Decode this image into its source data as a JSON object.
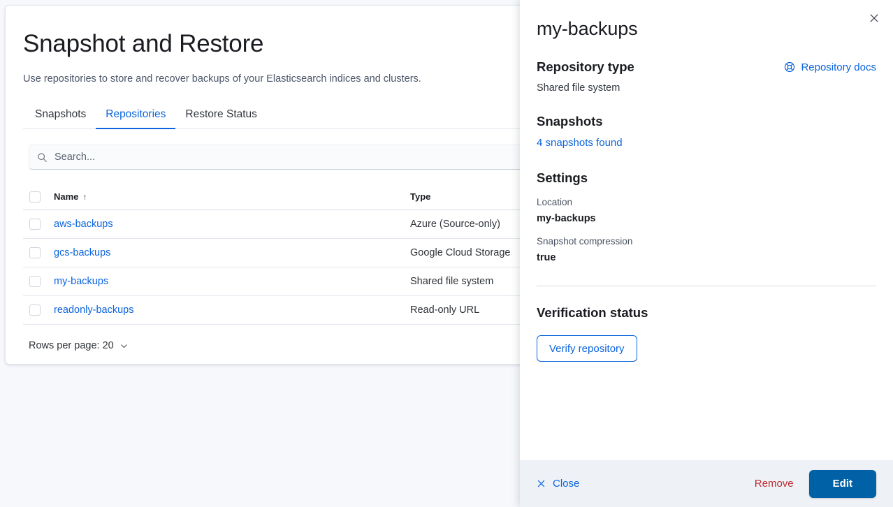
{
  "page": {
    "title": "Snapshot and Restore",
    "subtitle": "Use repositories to store and recover backups of your Elasticsearch indices and clusters."
  },
  "tabs": [
    {
      "label": "Snapshots",
      "active": false
    },
    {
      "label": "Repositories",
      "active": true
    },
    {
      "label": "Restore Status",
      "active": false
    }
  ],
  "search": {
    "placeholder": "Search...",
    "value": "",
    "icon": "search-icon"
  },
  "table": {
    "columns": [
      {
        "key": "name",
        "label": "Name",
        "sorted": true,
        "sort_arrow": "↑"
      },
      {
        "key": "type",
        "label": "Type"
      }
    ],
    "rows": [
      {
        "name": "aws-backups",
        "type": "Azure (Source-only)"
      },
      {
        "name": "gcs-backups",
        "type": "Google Cloud Storage"
      },
      {
        "name": "my-backups",
        "type": "Shared file system"
      },
      {
        "name": "readonly-backups",
        "type": "Read-only URL"
      }
    ]
  },
  "pagination": {
    "rows_per_page_label": "Rows per page: 20",
    "chevron_icon": "chevron-down-icon"
  },
  "flyout": {
    "title": "my-backups",
    "close_icon": "close-icon",
    "repository_type": {
      "heading": "Repository type",
      "value": "Shared file system",
      "docs_link": "Repository docs",
      "docs_icon": "lifesaver-help-icon"
    },
    "snapshots": {
      "heading": "Snapshots",
      "link": "4 snapshots found"
    },
    "settings": {
      "heading": "Settings",
      "fields": [
        {
          "label": "Location",
          "value": "my-backups"
        },
        {
          "label": "Snapshot compression",
          "value": "true"
        }
      ]
    },
    "verification": {
      "heading": "Verification status",
      "button": "Verify repository"
    },
    "footer": {
      "close_label": "Close",
      "close_icon": "close-icon",
      "remove_label": "Remove",
      "edit_label": "Edit"
    }
  },
  "colors": {
    "accent_link": "#0b64dd",
    "primary_button": "#0061a6",
    "danger": "#bd2c33",
    "page_background": "#f7f8fc",
    "footer_background": "#eef2f7",
    "border": "#e3e6ef"
  }
}
